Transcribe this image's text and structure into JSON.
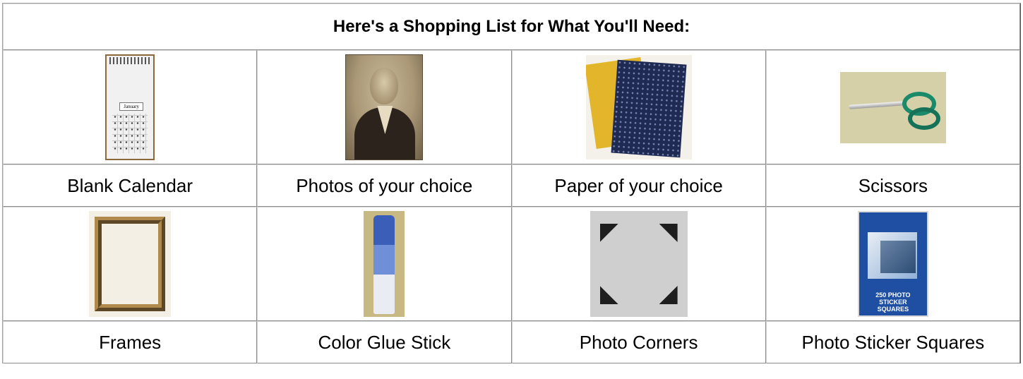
{
  "title": "Here's a Shopping List for What You'll Need:",
  "items": [
    {
      "label": "Blank Calendar",
      "image": "blank-calendar"
    },
    {
      "label": "Photos of your choice",
      "image": "vintage-photo"
    },
    {
      "label": "Paper of your choice",
      "image": "patterned-paper"
    },
    {
      "label": "Scissors",
      "image": "scissors"
    },
    {
      "label": "Frames",
      "image": "paper-frame"
    },
    {
      "label": "Color Glue Stick",
      "image": "glue-stick"
    },
    {
      "label": "Photo Corners",
      "image": "photo-corners"
    },
    {
      "label": "Photo Sticker Squares",
      "image": "sticker-squares-package"
    }
  ],
  "image_text": {
    "calendar_month": "January",
    "sticker_package": "250 PHOTO STICKER SQUARES"
  }
}
